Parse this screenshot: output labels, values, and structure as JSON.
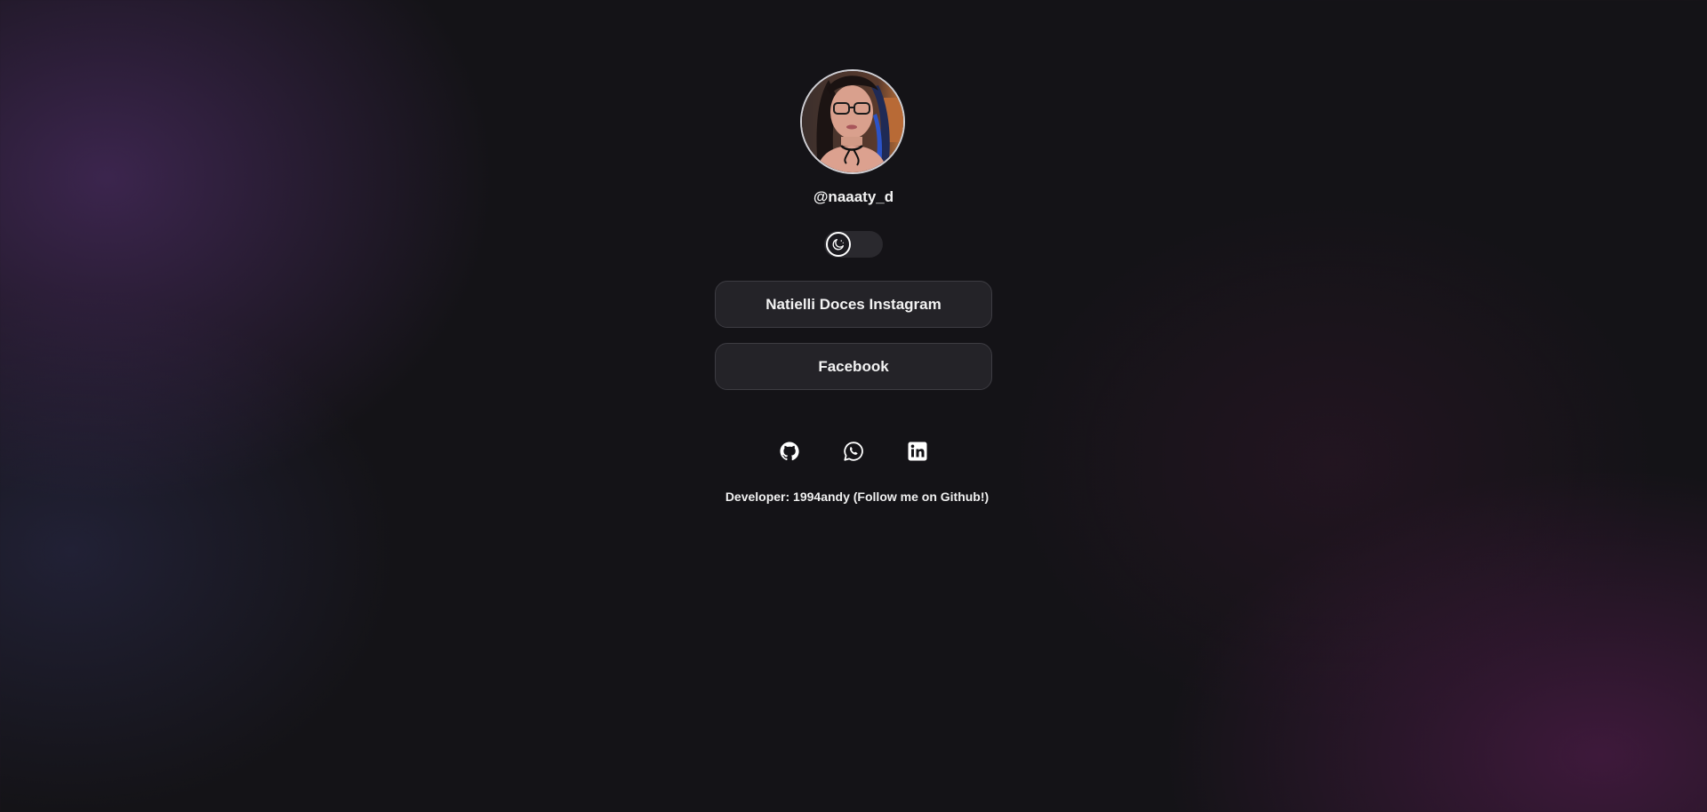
{
  "profile": {
    "username": "@naaaty_d",
    "avatar_icon": "profile-photo"
  },
  "theme_toggle": {
    "icon": "moon-icon",
    "state": "dark"
  },
  "links": [
    {
      "label": "Natielli Doces Instagram"
    },
    {
      "label": "Facebook"
    }
  ],
  "social_icons": [
    "github-icon",
    "whatsapp-icon",
    "linkedin-icon"
  ],
  "footer": {
    "text": "Developer: 1994andy (Follow me on Github!)"
  },
  "colors": {
    "background": "#141317",
    "accent_purple": "#5c347a",
    "accent_magenta": "#601e58",
    "button_bg": "#26252a",
    "button_border": "#3d3c42",
    "text": "#ffffff"
  }
}
